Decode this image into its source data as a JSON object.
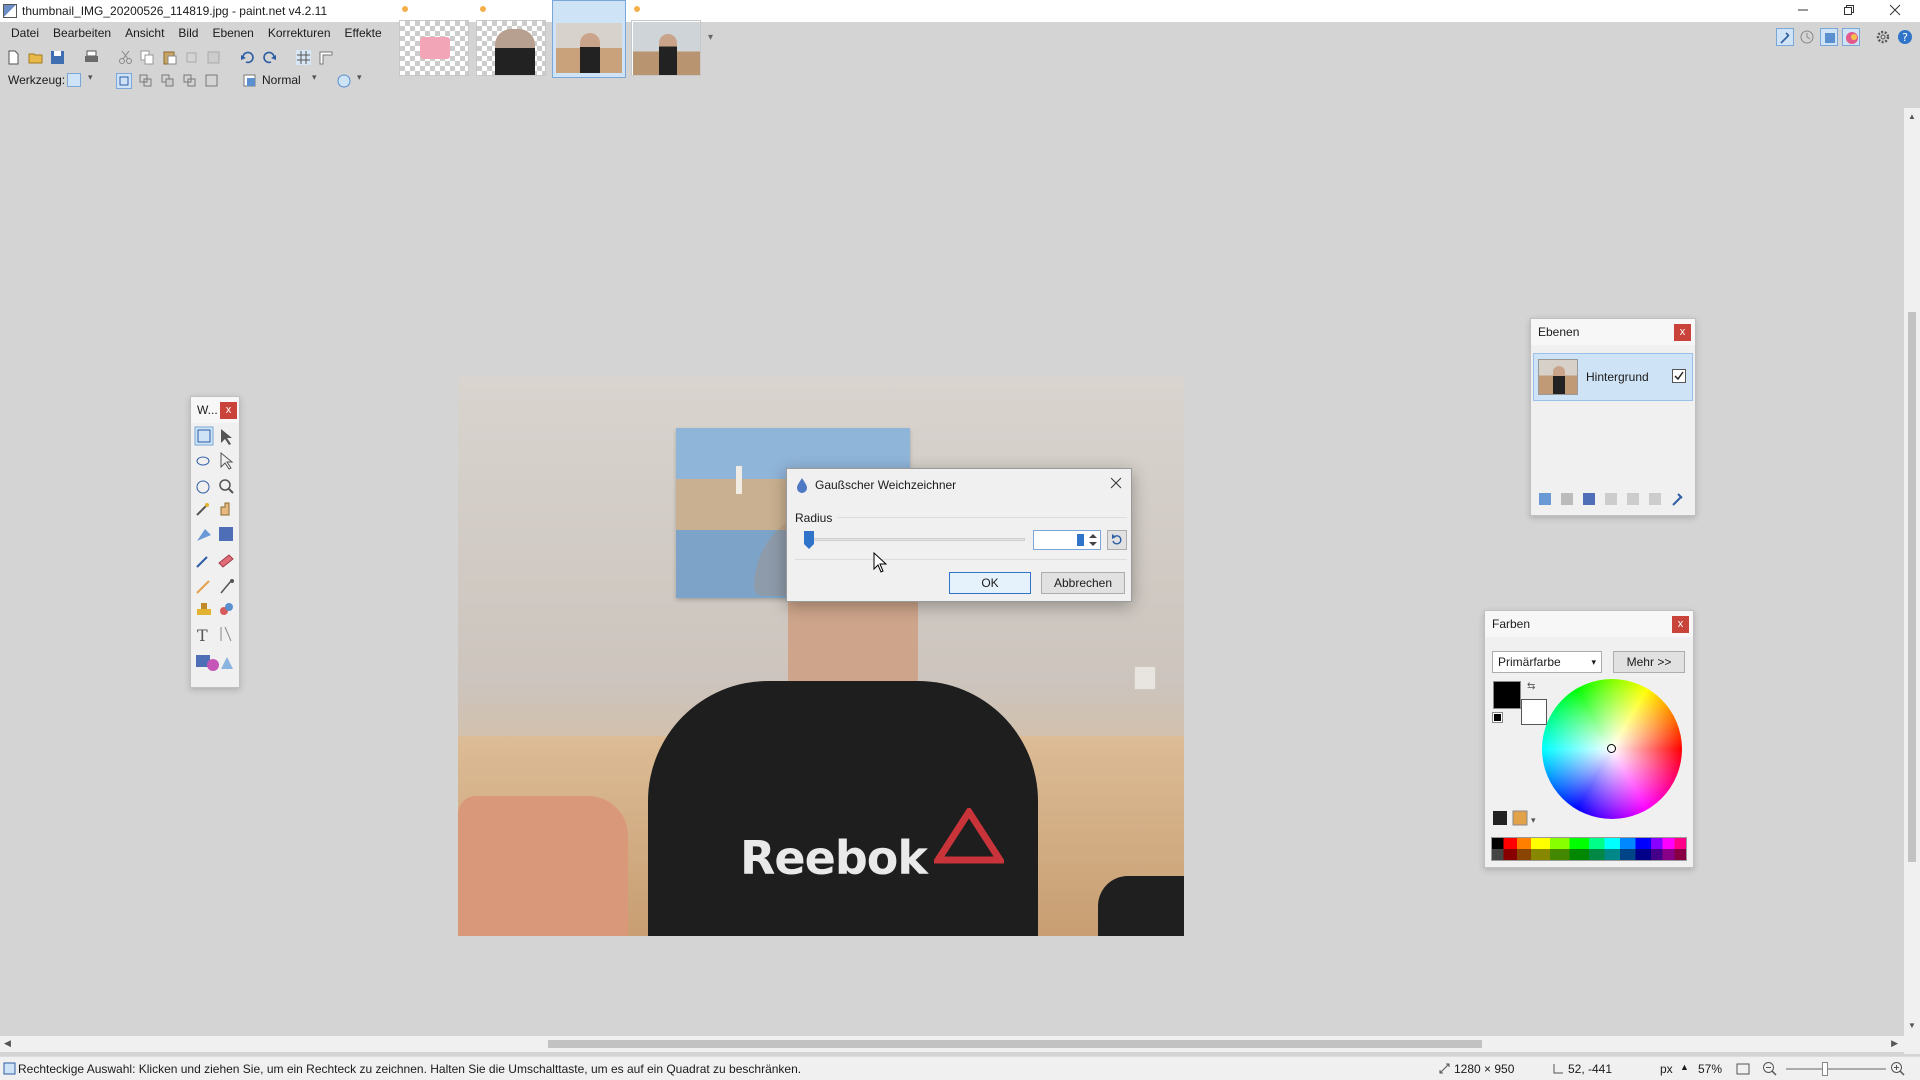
{
  "window": {
    "title": "thumbnail_IMG_20200526_114819.jpg - paint.net v4.2.11",
    "minimize_icon": "minimize-icon",
    "maximize_icon": "restore-icon",
    "close_icon": "close-icon"
  },
  "menu": [
    "Datei",
    "Bearbeiten",
    "Ansicht",
    "Bild",
    "Ebenen",
    "Korrekturen",
    "Effekte"
  ],
  "toolbar2": {
    "tool_label": "Werkzeug:",
    "blend_mode": "Normal"
  },
  "layers_panel": {
    "title": "Ebenen",
    "close": "x",
    "layer_name": "Hintergrund",
    "layer_visible": true
  },
  "colors_panel": {
    "title": "Farben",
    "close": "x",
    "select_value": "Primärfarbe",
    "more_button": "Mehr >>",
    "primary_color": "#000000",
    "secondary_color": "#ffffff"
  },
  "tools_panel": {
    "title": "W...",
    "close": "x"
  },
  "dialog": {
    "title": "Gaußscher Weichzeichner",
    "radius_label": "Radius",
    "radius_value": "",
    "ok": "OK",
    "cancel": "Abbrechen"
  },
  "image": {
    "shirt_text": "Reebok"
  },
  "status": {
    "hint": "Rechteckige Auswahl: Klicken und ziehen Sie, um ein Rechteck zu zeichnen. Halten Sie die Umschalttaste, um es auf ein Quadrat zu beschränken.",
    "image_size": "1280 × 950",
    "cursor_pos": "52, -441",
    "unit": "px",
    "zoom": "57%"
  },
  "colors": {
    "accent": "#2f74c9",
    "close_red": "#c9433b",
    "selection": "#cfe3f6"
  }
}
